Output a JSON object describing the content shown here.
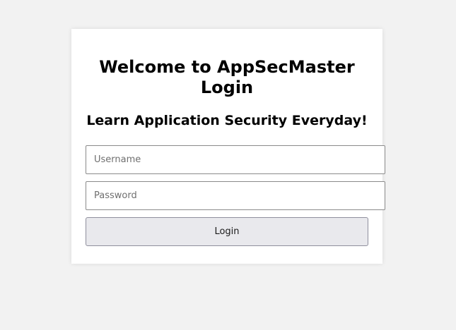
{
  "login": {
    "title": "Welcome to AppSecMaster Login",
    "subtitle": "Learn Application Security Everyday!",
    "username": {
      "placeholder": "Username",
      "value": ""
    },
    "password": {
      "placeholder": "Password",
      "value": ""
    },
    "submit_label": "Login"
  },
  "colors": {
    "page_background": "#f2f2f2",
    "card_background": "#ffffff",
    "button_background": "#e9e9ed",
    "text": "#000000"
  }
}
